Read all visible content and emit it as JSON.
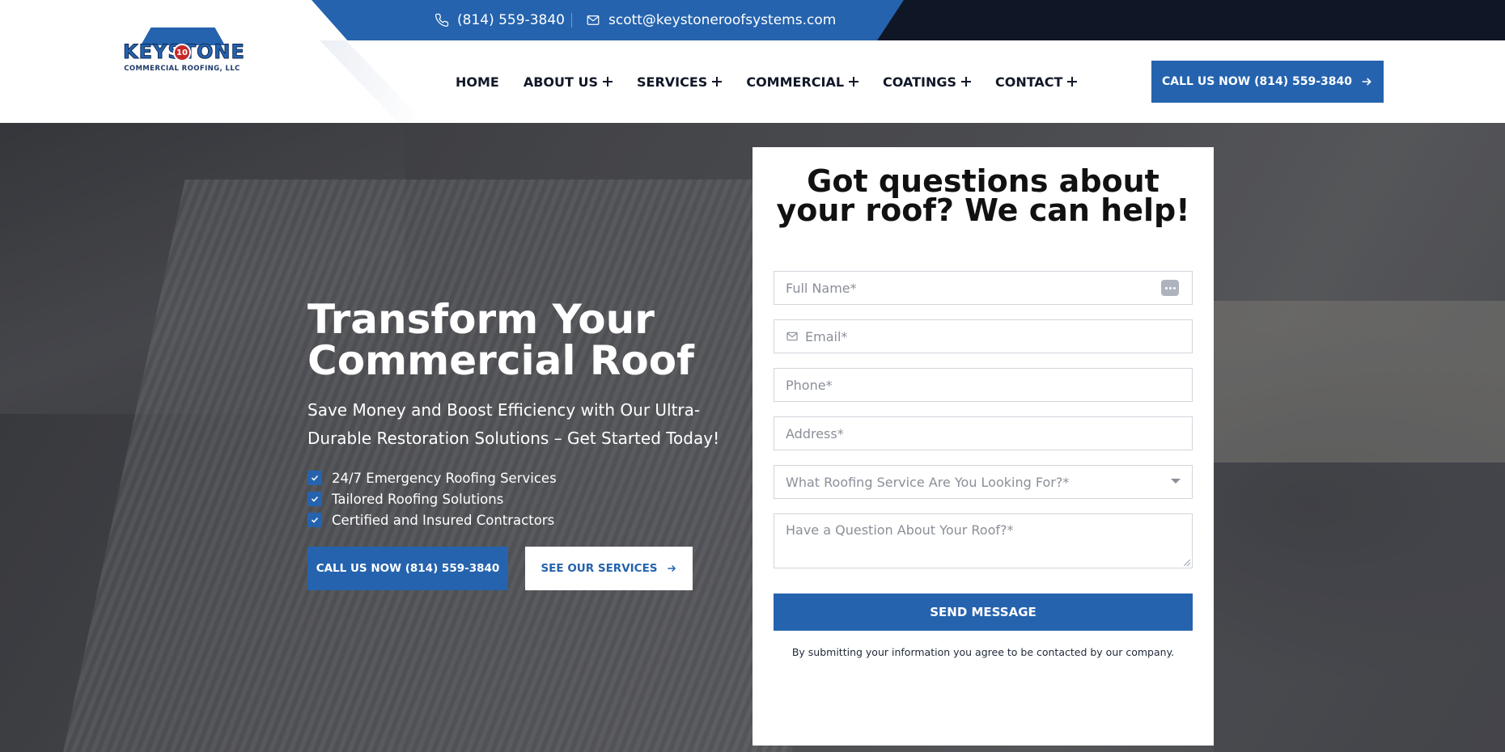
{
  "topbar": {
    "phone": "(814) 559-3840",
    "email": "scott@keystoneroofsystems.com",
    "phone_icon": "phone-icon",
    "email_icon": "mail-icon"
  },
  "logo": {
    "name": "KEYSTONE",
    "badge": "10",
    "tagline": "COMMERCIAL ROOFING, LLC"
  },
  "nav": {
    "items": [
      {
        "label": "HOME",
        "has_submenu": false
      },
      {
        "label": "ABOUT US",
        "has_submenu": true
      },
      {
        "label": "SERVICES",
        "has_submenu": true
      },
      {
        "label": "COMMERCIAL",
        "has_submenu": true
      },
      {
        "label": "COATINGS",
        "has_submenu": true
      },
      {
        "label": "CONTACT",
        "has_submenu": true
      }
    ],
    "cta_label": "CALL US NOW (814) 559-3840"
  },
  "hero": {
    "title": "Transform Your Commercial Roof",
    "subtitle": "Save Money and Boost Efficiency with Our Ultra-Durable Restoration Solutions – Get Started Today!",
    "features": [
      "24/7 Emergency Roofing Services",
      "Tailored Roofing Solutions",
      "Certified and Insured Contractors"
    ],
    "primary_button": "CALL US NOW (814) 559-3840",
    "secondary_button": "SEE OUR SERVICES"
  },
  "form": {
    "title": "Got questions about your roof? We can help!",
    "full_name_placeholder": "Full Name*",
    "email_placeholder": "Email*",
    "phone_placeholder": "Phone*",
    "address_placeholder": "Address*",
    "service_select": "What Roofing Service Are You Looking For?*",
    "question_placeholder": "Have a Question About Your Roof?*",
    "submit_label": "SEND MESSAGE",
    "disclaimer": "By submitting your information you agree to be contacted by our company."
  },
  "colors": {
    "brand_blue": "#2563ae",
    "topbar_dark": "#0f1626",
    "text_dark": "#111827"
  }
}
